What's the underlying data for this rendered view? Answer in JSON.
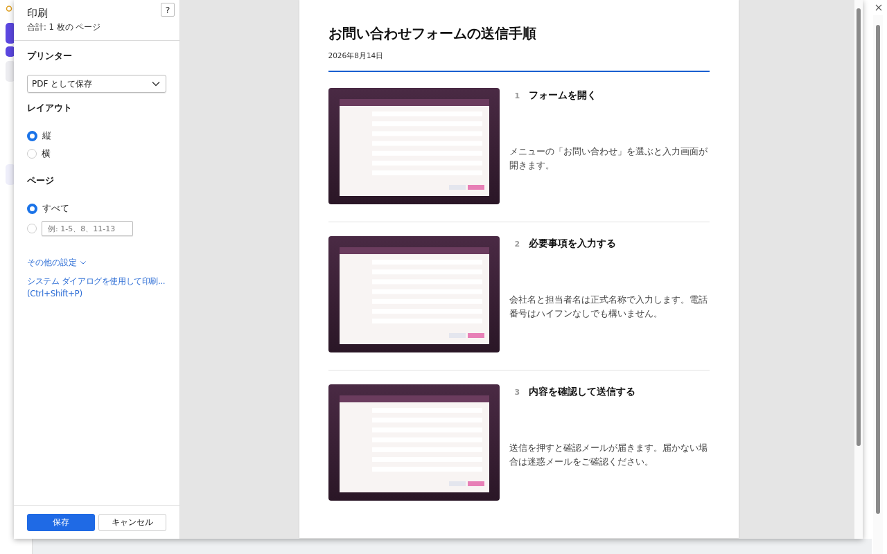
{
  "dialog": {
    "title": "印刷",
    "summary": "合計: 1 枚の ページ",
    "help_button": "?",
    "printer": {
      "label": "プリンター",
      "value": "PDF として保存"
    },
    "layout": {
      "label": "レイアウト",
      "options": [
        {
          "label": "縦",
          "selected": true
        },
        {
          "label": "横",
          "selected": false
        }
      ]
    },
    "pages": {
      "label": "ページ",
      "options": [
        {
          "kind": "all",
          "label": "すべて",
          "selected": true
        },
        {
          "kind": "custom",
          "placeholder": "例: 1-5、8、11-13",
          "selected": false
        }
      ]
    },
    "more_settings": "その他の設定",
    "system_dialog_link": "システム ダイアログを使用して印刷...",
    "system_dialog_shortcut": "(Ctrl+Shift+P)",
    "buttons": [
      {
        "label": "保存",
        "kind": "primary"
      },
      {
        "label": "キャンセル",
        "kind": "secondary"
      }
    ]
  },
  "preview": {
    "title": "お問い合わせフォームの送信手順",
    "date": "2026年8月14日",
    "steps": [
      {
        "number": "1",
        "title": "フォームを開く",
        "description": "メニューの「お問い合わせ」を選ぶと入力画面が開きます。"
      },
      {
        "number": "2",
        "title": "必要事項を入力する",
        "description": "会社名と担当者名は正式名称で入力します。電話番号はハイフンなしでも構いません。"
      },
      {
        "number": "3",
        "title": "内容を確認して送信する",
        "description": "送信を押すと確認メールが届きます。届かない場合は迷惑メールをご確認ください。"
      }
    ]
  }
}
